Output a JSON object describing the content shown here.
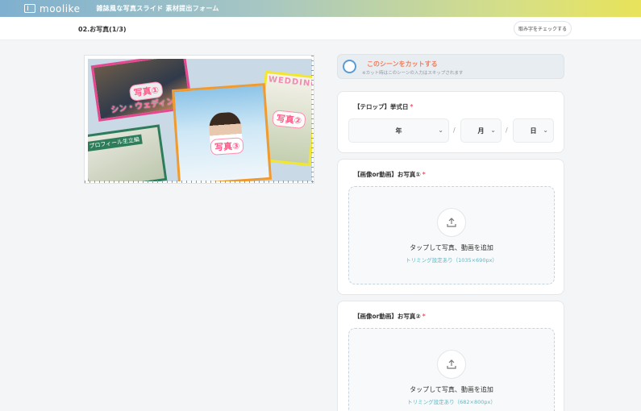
{
  "header": {
    "logo_text": "moolike",
    "form_title": "雑誌風な写真スライド 素材提出フォーム"
  },
  "subheader": {
    "page_title": "02.お写真(1/3)",
    "check_button": "取み字をチェックする"
  },
  "preview": {
    "labels": [
      "写真①",
      "写真②",
      "写真③"
    ],
    "texts": [
      "シン・ウェディング",
      "プロフィール生立編",
      "WEDDING"
    ]
  },
  "cut_scene": {
    "title": "このシーンをカットする",
    "note": "※カット時はこのシーンの入力はスキップされます"
  },
  "date_field": {
    "label": "【テロップ】挙式日",
    "required_mark": "*",
    "year": "年",
    "month": "月",
    "day": "日",
    "separator": "/"
  },
  "photo_fields": [
    {
      "label": "【画像or動画】お写真①",
      "required_mark": "*",
      "upload_text": "タップして写真、動画を追加",
      "trim_note": "トリミング設定あり（1035×690px）"
    },
    {
      "label": "【画像or動画】お写真②",
      "required_mark": "*",
      "upload_text": "タップして写真、動画を追加",
      "trim_note": "トリミング設定あり（682×800px）"
    }
  ],
  "colors": {
    "accent": "#5b9bd5",
    "cut_title": "#f47b5a",
    "required": "#ff4d6a",
    "trim_note": "#61b8c6"
  }
}
